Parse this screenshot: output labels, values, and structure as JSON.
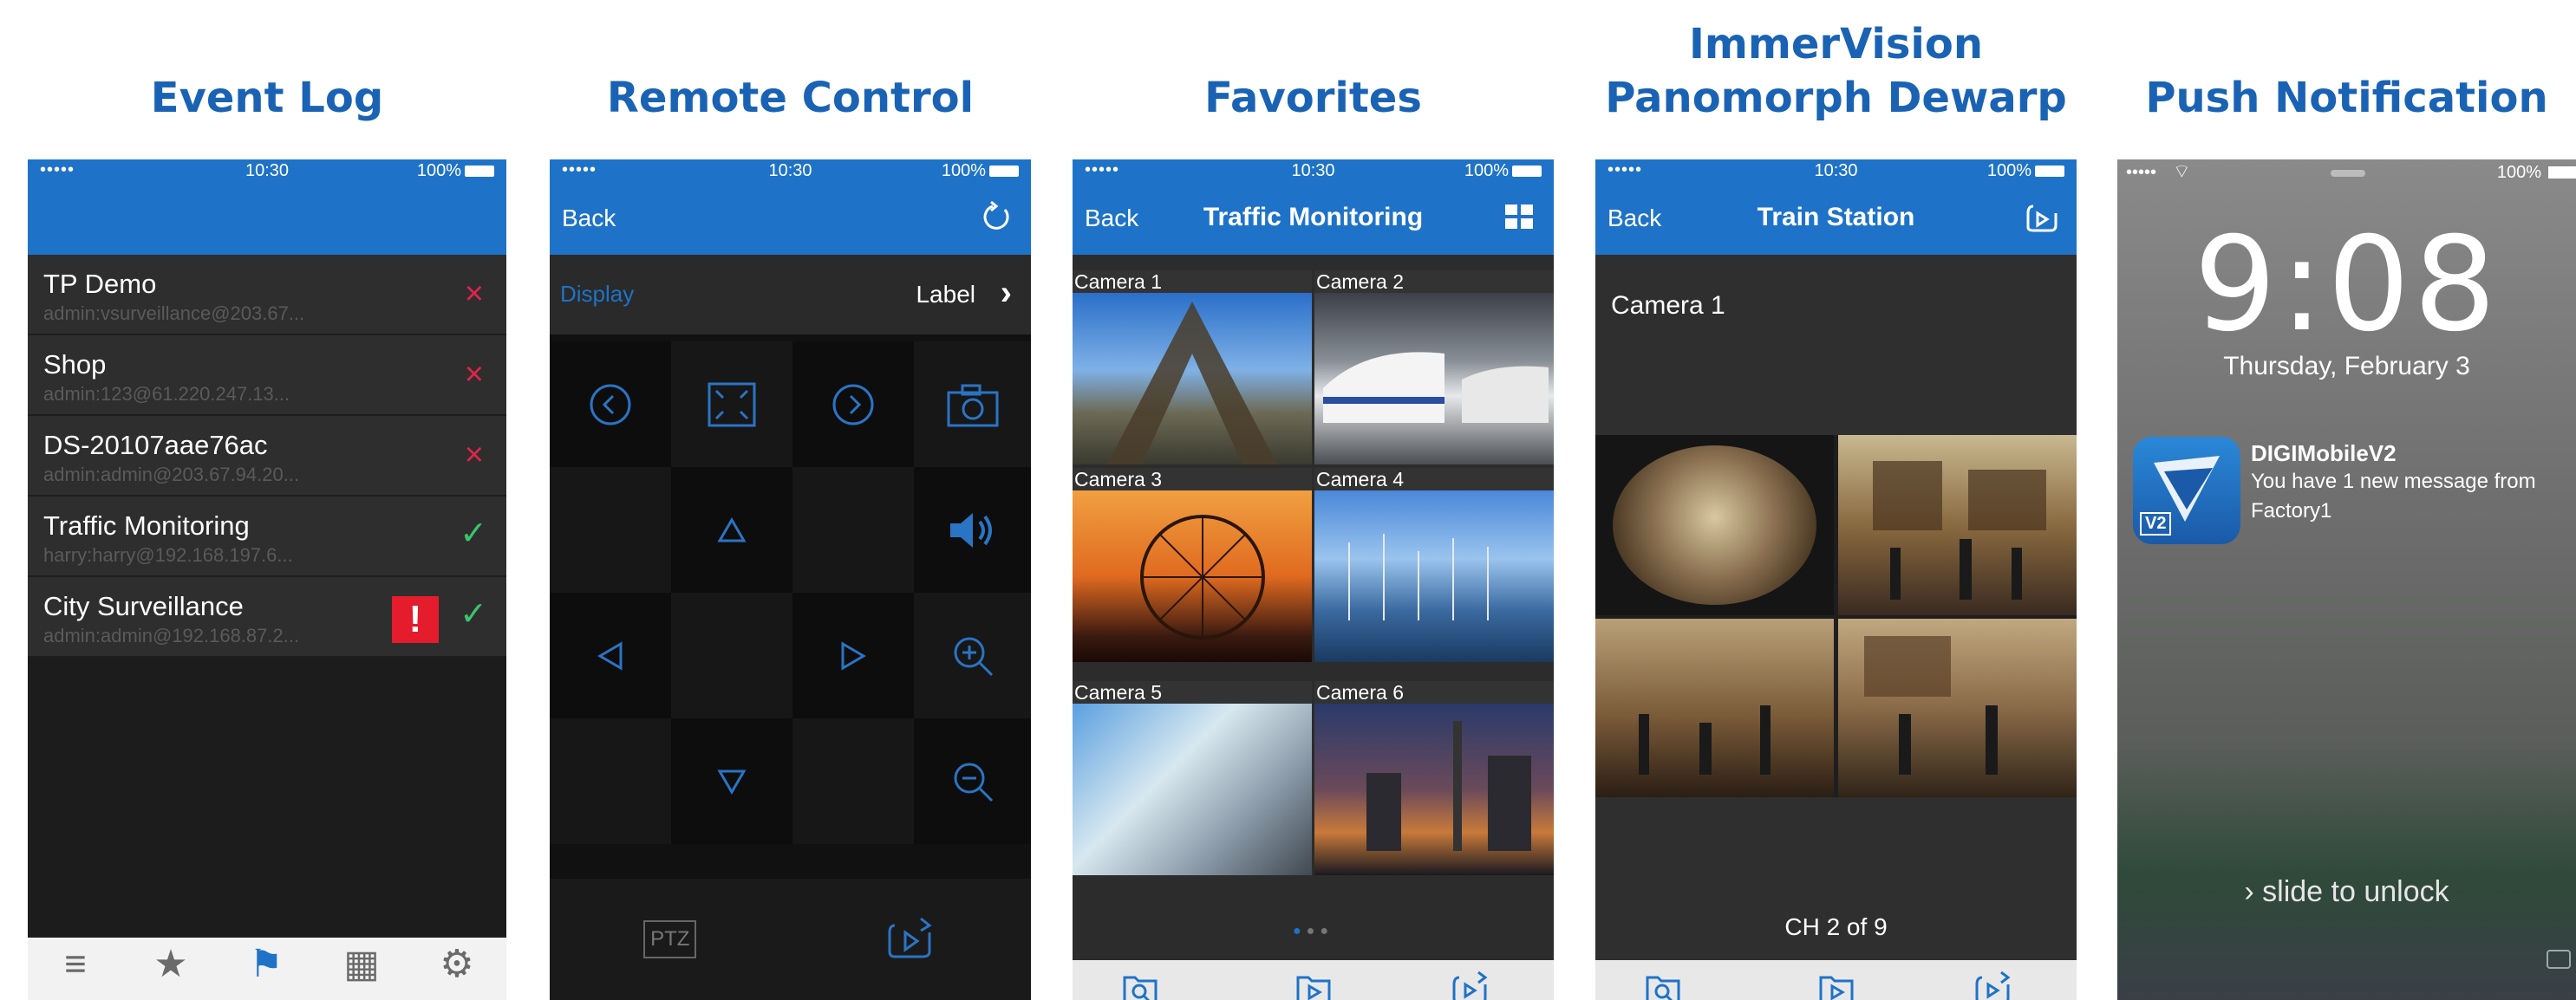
{
  "titles": {
    "event_log": "Event Log",
    "remote_control": "Remote Control",
    "favorites": "Favorites",
    "immervision_line1": "ImmerVision",
    "immervision_line2": "Panomorph Dewarp",
    "push": "Push Notification"
  },
  "status": {
    "signal": "•••••",
    "time": "10:30",
    "battery": "100%"
  },
  "event_log": {
    "rows": [
      {
        "name": "TP Demo",
        "sub": "admin:vsurveillance@203.67...",
        "status": "×"
      },
      {
        "name": "Shop",
        "sub": "admin:123@61.220.247.13...",
        "status": "×"
      },
      {
        "name": "DS-20107aae76ac",
        "sub": "admin:admin@203.67.94.20...",
        "status": "×"
      },
      {
        "name": "Traffic Monitoring",
        "sub": "harry:harry@192.168.197.6...",
        "status": "✓"
      },
      {
        "name": "City Surveillance",
        "sub": "admin:admin@192.168.87.2...",
        "status": "✓",
        "alert": "!"
      }
    ],
    "tabs": [
      "≡",
      "★",
      "⚑",
      "▦",
      "⚙"
    ]
  },
  "remote": {
    "back": "Back",
    "display_label": "Display",
    "display_value": "Label",
    "ptz": "PTZ"
  },
  "favorites": {
    "back": "Back",
    "title": "Traffic Monitoring",
    "cameras": [
      "Camera 1",
      "Camera 2",
      "Camera 3",
      "Camera 4",
      "Camera 5",
      "Camera 6"
    ]
  },
  "train": {
    "back": "Back",
    "title": "Train Station",
    "camera": "Camera 1",
    "channel": "CH 2 of 9"
  },
  "lock": {
    "signal": "••••• ",
    "battery": "100%",
    "time": "9:08",
    "date": "Thursday, February 3",
    "app_name": "DIGIMobileV2",
    "app_badge": "V2",
    "message": "You have 1 new message from",
    "message2": "Factory1",
    "slide": "slide to unlock"
  },
  "colors": {
    "accent": "#1e73c8",
    "title": "#1a63b4",
    "danger": "#e0244c",
    "ok": "#3cc36b"
  }
}
